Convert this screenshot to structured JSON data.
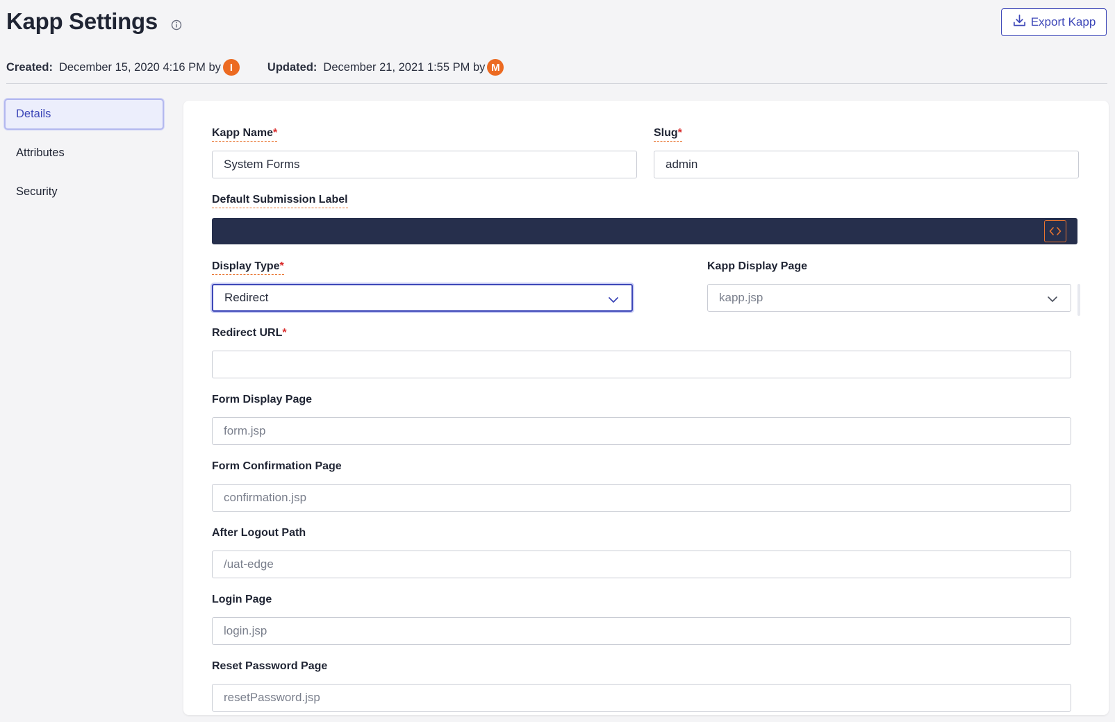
{
  "header": {
    "title": "Kapp Settings",
    "info_icon": "info-circle-icon",
    "export_label": "Export Kapp",
    "export_icon": "download-icon"
  },
  "meta": {
    "created_label": "Created:",
    "created_value": "December 15, 2020 4:16 PM by",
    "created_avatar": "I",
    "updated_label": "Updated:",
    "updated_value": "December 21, 2021 1:55 PM by",
    "updated_avatar": "M",
    "avatar_color": "#ec6a21"
  },
  "sidebar": {
    "items": [
      {
        "label": "Details",
        "active": true
      },
      {
        "label": "Attributes",
        "active": false
      },
      {
        "label": "Security",
        "active": false
      }
    ]
  },
  "form": {
    "kapp_name": {
      "label": "Kapp Name",
      "required": "*",
      "value": "System Forms"
    },
    "slug": {
      "label": "Slug",
      "required": "*",
      "value": "admin"
    },
    "default_submission_label": {
      "label": "Default Submission Label",
      "code_icon": "code-brackets-icon"
    },
    "display_type": {
      "label": "Display Type",
      "required": "*",
      "value": "Redirect"
    },
    "kapp_display_page": {
      "label": "Kapp Display Page",
      "value": "kapp.jsp"
    },
    "redirect_url": {
      "label": "Redirect URL",
      "required": "*",
      "value": ""
    },
    "form_display_page": {
      "label": "Form Display Page",
      "placeholder": "form.jsp"
    },
    "form_confirmation_page": {
      "label": "Form Confirmation Page",
      "placeholder": "confirmation.jsp"
    },
    "after_logout_path": {
      "label": "After Logout Path",
      "placeholder": "/uat-edge"
    },
    "login_page": {
      "label": "Login Page",
      "placeholder": "login.jsp"
    },
    "reset_password_page": {
      "label": "Reset Password Page",
      "placeholder": "resetPassword.jsp"
    }
  },
  "colors": {
    "accent": "#3d47b8",
    "orange": "#e8742f",
    "required": "#d92c2c",
    "code_bar": "#262f4c"
  }
}
